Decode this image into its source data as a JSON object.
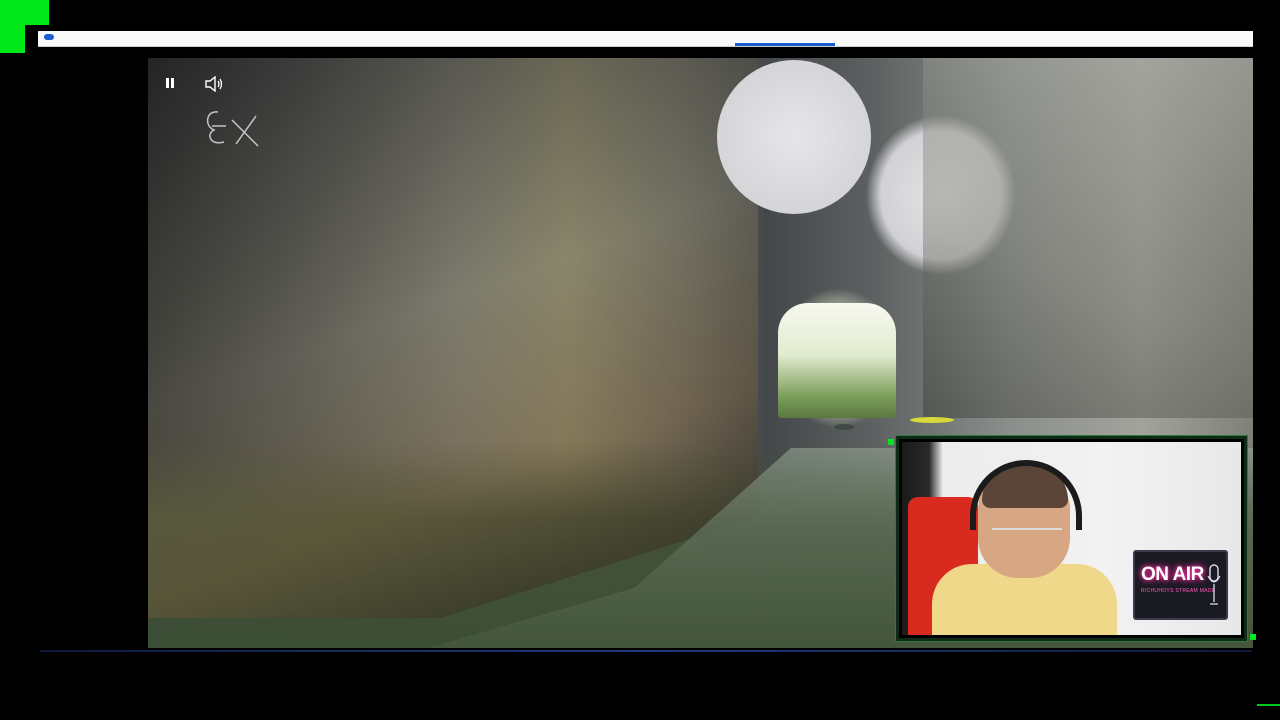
{
  "overlay": {
    "accent_color": "#00e71a",
    "webcam_sign": {
      "title": "ON AIR",
      "subtitle": "RICHUHOYS STREAM MADE"
    }
  },
  "player": {
    "controls": [
      "pause-icon",
      "volume-icon"
    ],
    "watermark": "EX-logo"
  }
}
